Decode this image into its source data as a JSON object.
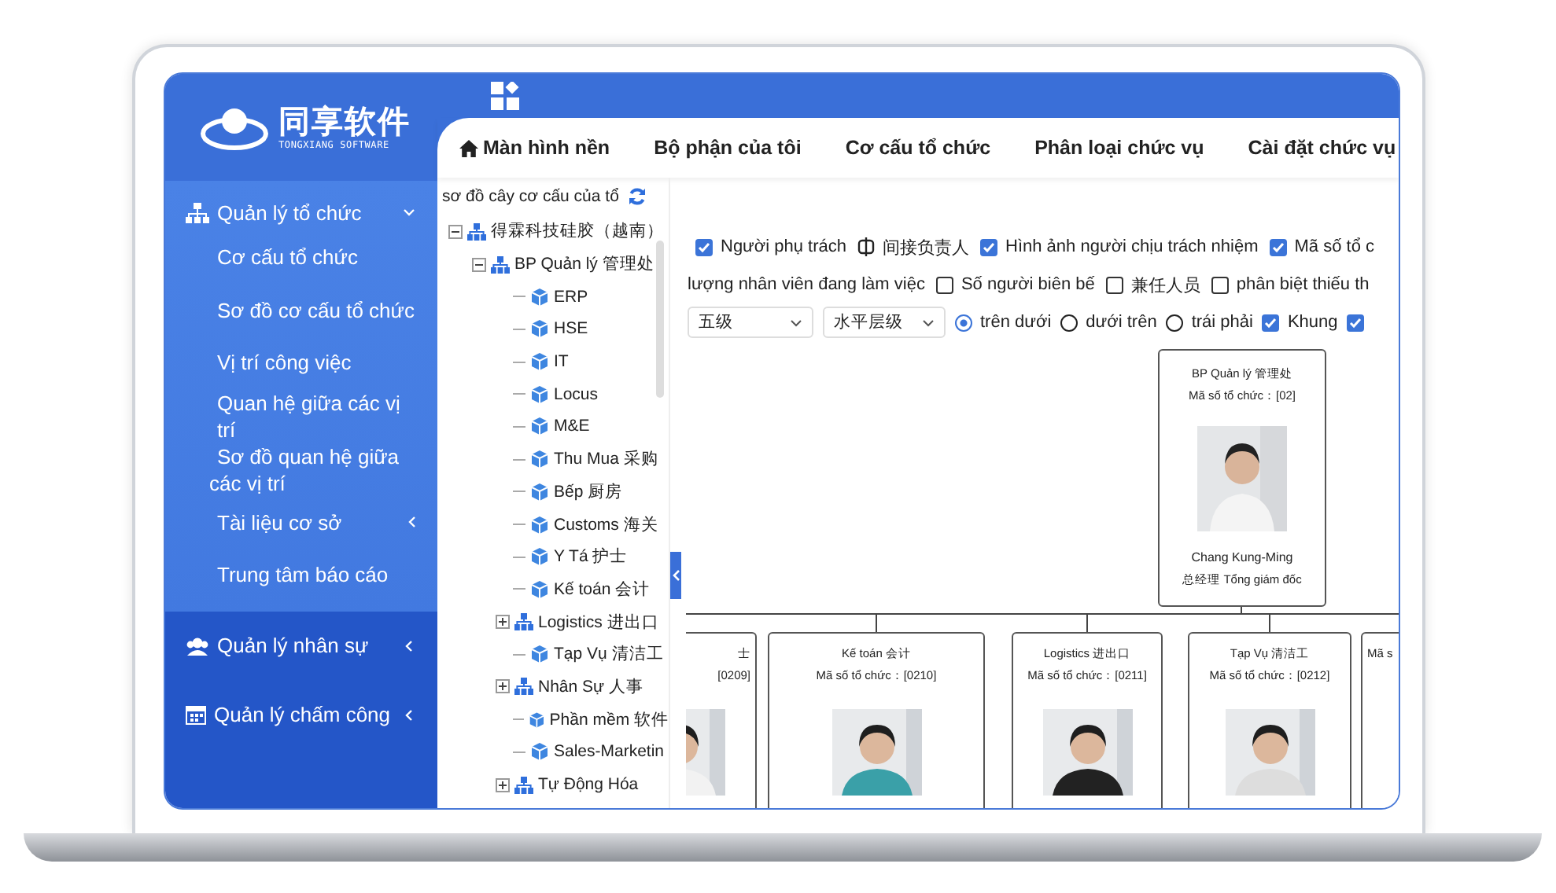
{
  "logo": {
    "name": "同享软件",
    "subtitle": "TONGXIANG SOFTWARE"
  },
  "sidebar": {
    "groups": [
      {
        "label": "Quản lý tổ chức",
        "expanded": true,
        "items": [
          {
            "label": "Cơ cấu tổ chức"
          },
          {
            "label": "Sơ đồ cơ cấu tổ chức"
          },
          {
            "label": "Vị trí công việc"
          },
          {
            "label": "Quan hệ giữa các vị trí"
          },
          {
            "label": "Sơ đồ quan hệ giữa các vị trí"
          },
          {
            "label": "Tài liệu cơ sở",
            "expanded": false
          },
          {
            "label": "Trung tâm báo cáo"
          }
        ]
      },
      {
        "label": "Quản lý nhân sự",
        "expanded": false
      },
      {
        "label": "Quản lý chấm công",
        "expanded": false
      }
    ]
  },
  "tabs": [
    {
      "label": "Màn hình nền"
    },
    {
      "label": "Bộ phận của tôi"
    },
    {
      "label": "Cơ cấu tổ chức"
    },
    {
      "label": "Phân loại chức vụ"
    },
    {
      "label": "Cài đặt chức vụ"
    }
  ],
  "tree": {
    "title": "sơ đồ cây cơ cấu của tổ",
    "nodes": [
      {
        "label": "得霖科技硅胶（越南）",
        "kind": "group",
        "expanded": true,
        "children": [
          {
            "label": "BP Quản lý 管理处",
            "kind": "group",
            "expanded": true,
            "children": [
              {
                "label": "ERP",
                "kind": "leaf"
              },
              {
                "label": "HSE",
                "kind": "leaf"
              },
              {
                "label": "IT",
                "kind": "leaf"
              },
              {
                "label": "Locus",
                "kind": "leaf"
              },
              {
                "label": "M&E",
                "kind": "leaf"
              },
              {
                "label": "Thu Mua 采购",
                "kind": "leaf"
              },
              {
                "label": "Bếp 厨房",
                "kind": "leaf"
              },
              {
                "label": "Customs 海关",
                "kind": "leaf"
              },
              {
                "label": "Y Tá 护士",
                "kind": "leaf"
              },
              {
                "label": "Kế toán 会计",
                "kind": "leaf"
              },
              {
                "label": "Logistics 进出口",
                "kind": "group",
                "expanded": false
              },
              {
                "label": "Tạp Vụ 清洁工",
                "kind": "leaf"
              },
              {
                "label": "Nhân Sự 人事",
                "kind": "group",
                "expanded": false
              },
              {
                "label": "Phần mềm 软件",
                "kind": "leaf"
              },
              {
                "label": "Sales-Marketin",
                "kind": "leaf"
              },
              {
                "label": "Tự Động Hóa",
                "kind": "group",
                "expanded": false
              }
            ]
          }
        ]
      }
    ]
  },
  "options": [
    [
      {
        "kind": "checkbox",
        "label": "Người phụ trách",
        "checked": true
      },
      {
        "kind": "icon-label",
        "label": "间接负责人"
      },
      {
        "kind": "checkbox",
        "label": "Hình ảnh người chịu trách nhiệm",
        "checked": true
      },
      {
        "kind": "checkbox",
        "label": "Mã số tổ c",
        "checked": true
      }
    ],
    [
      {
        "kind": "text",
        "label": "lượng nhân viên đang làm việc"
      },
      {
        "kind": "checkbox",
        "label": "Số người biên bế",
        "checked": false
      },
      {
        "kind": "checkbox",
        "label": "兼任人员",
        "checked": false
      },
      {
        "kind": "checkbox",
        "label": "phân biệt thiếu th",
        "checked": false
      }
    ],
    [
      {
        "kind": "select",
        "value": "五级"
      },
      {
        "kind": "select",
        "value": "水平层级"
      },
      {
        "kind": "radio",
        "label": "trên dưới",
        "selected": true
      },
      {
        "kind": "radio",
        "label": "dưới trên",
        "selected": false
      },
      {
        "kind": "radio",
        "label": "trái phải",
        "selected": false
      },
      {
        "kind": "checkbox",
        "label": "Khung",
        "checked": true
      },
      {
        "kind": "checkbox",
        "checked": true
      }
    ]
  ],
  "org_chart": {
    "root": {
      "name": "BP Quản lý 管理处",
      "code": "Mã số tổ chức：[02]",
      "photo": true,
      "person": "Chang Kung-Ming",
      "position": "总经理 Tổng giám đốc"
    },
    "children": [
      {
        "name": "士",
        "code": "[0209]",
        "photo": true
      },
      {
        "name": "Kế toán 会计",
        "code": "Mã số tổ chức：[0210]",
        "photo": true
      },
      {
        "name": "Logistics 进出口",
        "code": "Mã số tổ chức：[0211]",
        "photo": true
      },
      {
        "name": "Tạp Vụ 清洁工",
        "code": "Mã số tổ chức：[0212]",
        "photo": true
      },
      {
        "code": "Mã s"
      }
    ]
  }
}
